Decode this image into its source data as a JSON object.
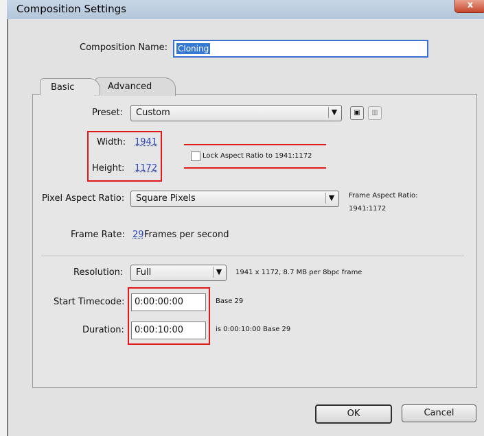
{
  "window": {
    "title": "Composition Settings",
    "close_label": "x"
  },
  "composition_name": {
    "label": "Composition Name:",
    "value": "Cloning"
  },
  "tabs": [
    {
      "label": "Basic"
    },
    {
      "label": "Advanced"
    }
  ],
  "preset": {
    "label": "Preset:",
    "value": "Custom",
    "save_icon": "save-preset-icon",
    "delete_icon": "trash-icon"
  },
  "width": {
    "label": "Width:",
    "value": "1941"
  },
  "height": {
    "label": "Height:",
    "value": "1172"
  },
  "lock_aspect": {
    "label": "Lock Aspect Ratio to 1941:1172",
    "checked": false
  },
  "pixel_aspect": {
    "label": "Pixel Aspect Ratio:",
    "value": "Square Pixels",
    "frame_aspect_label": "Frame Aspect Ratio:",
    "frame_aspect_value": "1941:1172"
  },
  "frame_rate": {
    "label": "Frame Rate:",
    "value": "29",
    "unit": "Frames per second"
  },
  "resolution": {
    "label": "Resolution:",
    "value": "Full",
    "info": "1941 x 1172, 8.7 MB per 8bpc frame"
  },
  "start_timecode": {
    "label": "Start Timecode:",
    "value": "0:00:00:00",
    "info": "Base 29"
  },
  "duration": {
    "label": "Duration:",
    "value": "0:00:10:00",
    "info": "is 0:00:10:00  Base 29"
  },
  "buttons": {
    "ok": "OK",
    "cancel": "Cancel"
  },
  "colors": {
    "annotation_red": "#e01a1a",
    "selection_blue": "#3478d4",
    "link_blue": "#2b46b8"
  }
}
